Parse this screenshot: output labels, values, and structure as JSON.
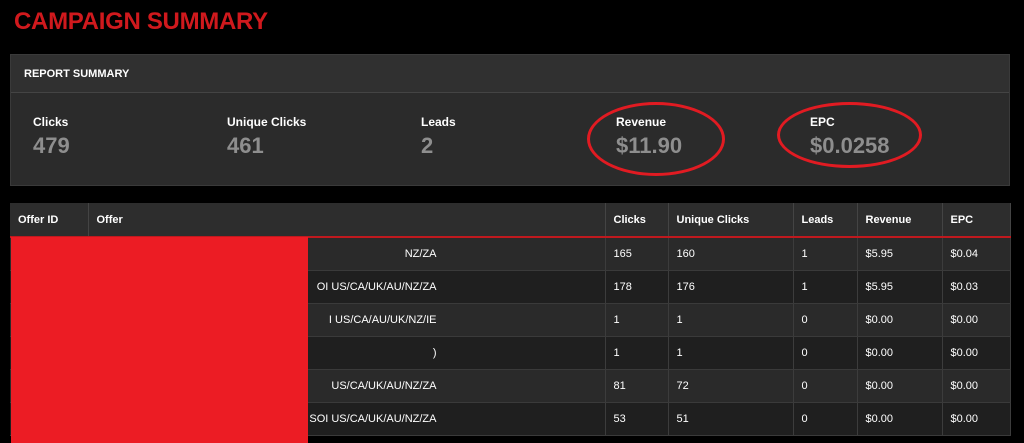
{
  "page": {
    "title": "CAMPAIGN SUMMARY"
  },
  "summary": {
    "header": "REPORT SUMMARY",
    "stats": [
      {
        "label": "Clicks",
        "value": "479"
      },
      {
        "label": "Unique Clicks",
        "value": "461"
      },
      {
        "label": "Leads",
        "value": "2"
      },
      {
        "label": "Revenue",
        "value": "$11.90"
      },
      {
        "label": "EPC",
        "value": "$0.0258"
      }
    ]
  },
  "table": {
    "columns": [
      "Offer ID",
      "Offer",
      "Clicks",
      "Unique Clicks",
      "Leads",
      "Revenue",
      "EPC"
    ],
    "rows": [
      {
        "offer_id": "",
        "offer": "NZ/ZA",
        "clicks": "165",
        "unique": "160",
        "leads": "1",
        "revenue": "$5.95",
        "epc": "$0.04"
      },
      {
        "offer_id": "",
        "offer": "OI US/CA/UK/AU/NZ/ZA",
        "clicks": "178",
        "unique": "176",
        "leads": "1",
        "revenue": "$5.95",
        "epc": "$0.03"
      },
      {
        "offer_id": "",
        "offer": "I US/CA/AU/UK/NZ/IE",
        "clicks": "1",
        "unique": "1",
        "leads": "0",
        "revenue": "$0.00",
        "epc": "$0.00"
      },
      {
        "offer_id": "",
        "offer": ")",
        "clicks": "1",
        "unique": "1",
        "leads": "0",
        "revenue": "$0.00",
        "epc": "$0.00"
      },
      {
        "offer_id": "",
        "offer": "US/CA/UK/AU/NZ/ZA",
        "clicks": "81",
        "unique": "72",
        "leads": "0",
        "revenue": "$0.00",
        "epc": "$0.00"
      },
      {
        "offer_id": "",
        "offer": "d SOI US/CA/UK/AU/NZ/ZA",
        "clicks": "53",
        "unique": "51",
        "leads": "0",
        "revenue": "$0.00",
        "epc": "$0.00"
      }
    ]
  },
  "colors": {
    "accent": "#d0191d",
    "redaction": "#ec1c24",
    "annotation": "#e11b22",
    "stat_value": "#8e8e8e"
  }
}
